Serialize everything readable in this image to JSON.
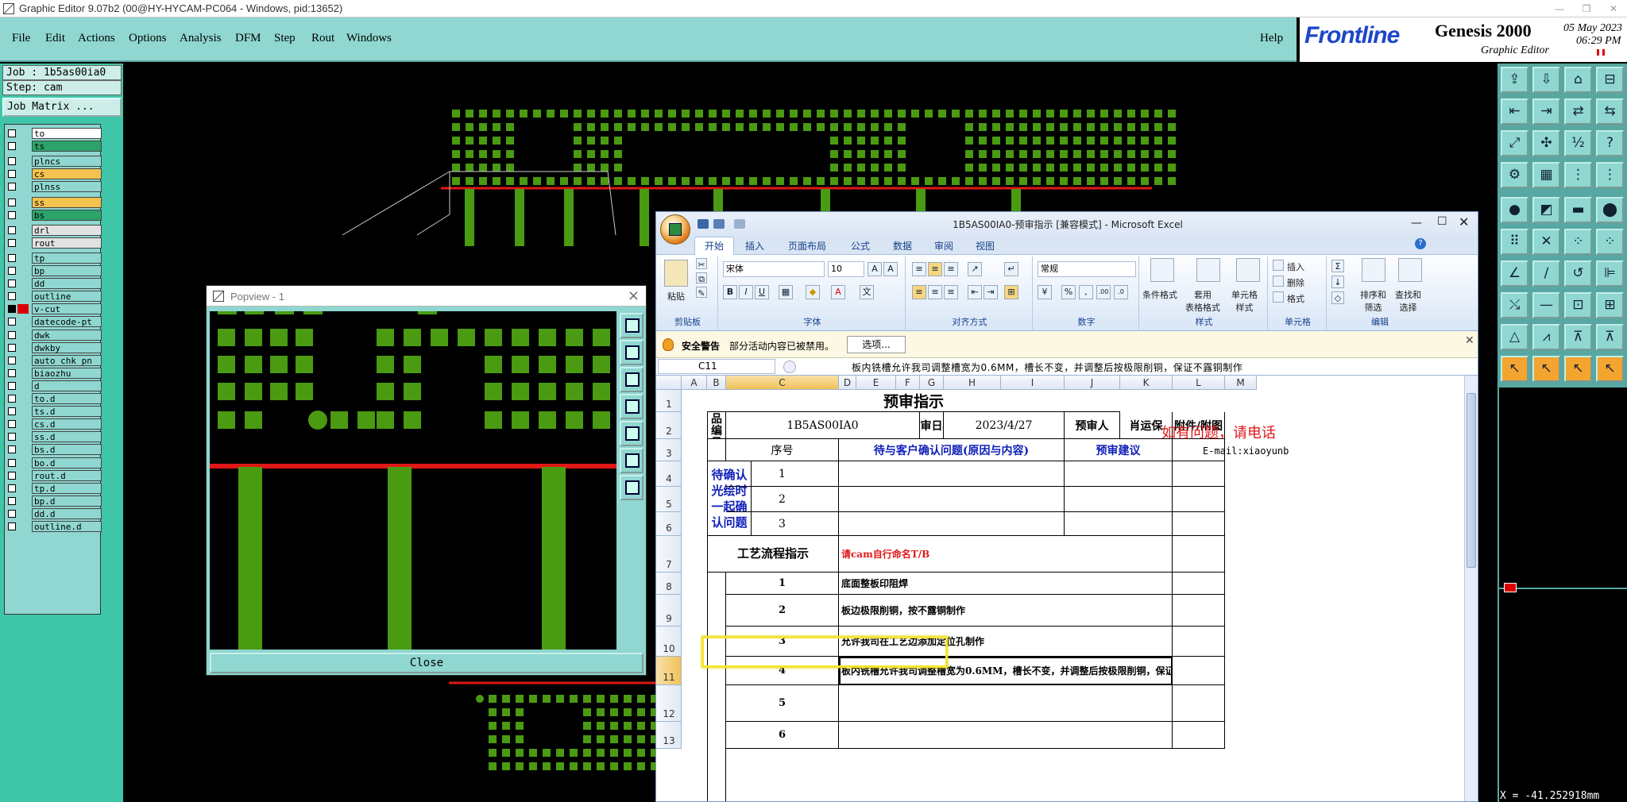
{
  "window": {
    "title": "Graphic Editor 9.07b2 (00@HY-HYCAM-PC064 - Windows, pid:13652)"
  },
  "menu": {
    "items": [
      "File",
      "Edit",
      "Actions",
      "Options",
      "Analysis",
      "DFM",
      "Step",
      "Rout",
      "Windows"
    ],
    "help": "Help"
  },
  "brand": {
    "logo": "Frontline",
    "product": "Genesis 2000",
    "subtitle": "Graphic Editor",
    "date": "05 May 2023",
    "time": "06:29 PM"
  },
  "job": {
    "job_line": "Job : 1b5as00ia0",
    "step_line": "Step: cam",
    "matrix_button": "Job Matrix ..."
  },
  "layers": [
    {
      "name": "to",
      "color": "#ffffff",
      "checked": false
    },
    {
      "name": "ts",
      "color": "#2ba36a",
      "checked": false
    },
    {
      "name": "plncs",
      "color": "#8fd7d0",
      "checked": false
    },
    {
      "name": "cs",
      "color": "#f3c24f",
      "checked": false
    },
    {
      "name": "plnss",
      "color": "#8fd7d0",
      "checked": false
    },
    {
      "name": "ss",
      "color": "#f3c24f",
      "checked": false
    },
    {
      "name": "bs",
      "color": "#2ba36a",
      "checked": false
    },
    {
      "name": "drl",
      "color": "#e2e2e2",
      "checked": false
    },
    {
      "name": "rout",
      "color": "#e2e2e2",
      "checked": false
    },
    {
      "name": "tp",
      "color": "#8fd7d0",
      "checked": false
    },
    {
      "name": "bp",
      "color": "#8fd7d0",
      "checked": false
    },
    {
      "name": "dd",
      "color": "#8fd7d0",
      "checked": false
    },
    {
      "name": "outline",
      "color": "#8fd7d0",
      "checked": false
    },
    {
      "name": "v-cut",
      "color": "#8fd7d0",
      "checked": true,
      "active": true
    },
    {
      "name": "datecode-pt",
      "color": "#8fd7d0",
      "checked": false
    },
    {
      "name": "dwk",
      "color": "#8fd7d0",
      "checked": false
    },
    {
      "name": "dwkby",
      "color": "#8fd7d0",
      "checked": false
    },
    {
      "name": "auto_chk_pn",
      "color": "#8fd7d0",
      "checked": false
    },
    {
      "name": "biaozhu",
      "color": "#8fd7d0",
      "checked": false
    },
    {
      "name": "d",
      "color": "#8fd7d0",
      "checked": false
    },
    {
      "name": "to.d",
      "color": "#8fd7d0",
      "checked": false
    },
    {
      "name": "ts.d",
      "color": "#8fd7d0",
      "checked": false
    },
    {
      "name": "cs.d",
      "color": "#8fd7d0",
      "checked": false
    },
    {
      "name": "ss.d",
      "color": "#8fd7d0",
      "checked": false
    },
    {
      "name": "bs.d",
      "color": "#8fd7d0",
      "checked": false
    },
    {
      "name": "bo.d",
      "color": "#8fd7d0",
      "checked": false
    },
    {
      "name": "rout.d",
      "color": "#8fd7d0",
      "checked": false
    },
    {
      "name": "tp.d",
      "color": "#8fd7d0",
      "checked": false
    },
    {
      "name": "bp.d",
      "color": "#8fd7d0",
      "checked": false
    },
    {
      "name": "dd.d",
      "color": "#8fd7d0",
      "checked": false
    },
    {
      "name": "outline.d",
      "color": "#8fd7d0",
      "checked": false
    }
  ],
  "popview": {
    "title": "Popview - 1",
    "close": "Close"
  },
  "coord": "X = -41.252918mm",
  "excel": {
    "title": "1B5AS00IA0-预审指示  [兼容模式] - Microsoft Excel",
    "tabs": [
      "开始",
      "插入",
      "页面布局",
      "公式",
      "数据",
      "审阅",
      "视图"
    ],
    "ribbon": {
      "paste": "粘贴",
      "clipboard": "剪贴板",
      "font_name": "宋体",
      "font_size": "10",
      "font": "字体",
      "align": "对齐方式",
      "number_format": "常规",
      "number": "数字",
      "cond_format": "条件格式",
      "table_format": "套用\n表格格式",
      "cell_style": "单元格\n样式",
      "style": "样式",
      "insert": "插入",
      "delete": "删除",
      "format": "格式",
      "cells": "单元格",
      "sort": "排序和\n筛选",
      "find": "查找和\n选择",
      "edit": "编辑"
    },
    "security": {
      "label": "安全警告",
      "message": "部分活动内容已被禁用。",
      "button": "选项..."
    },
    "name_box": "C11",
    "formula": "板内铣槽允许我司调整槽宽为0.6MM，槽长不变，并调整后按极限削铜，保证不露铜制作",
    "columns": [
      "A",
      "B",
      "C",
      "D",
      "E",
      "F",
      "G",
      "H",
      "I",
      "J",
      "K",
      "L",
      "M"
    ],
    "rows": [
      "1",
      "2",
      "3",
      "4",
      "5",
      "6",
      "7",
      "8",
      "9",
      "10",
      "11",
      "12",
      "13"
    ],
    "sheet": {
      "heading": "预审指示",
      "product_label": "产品编号",
      "product_no": "1B5AS00IA0",
      "date_label": "预审日期",
      "date": "2023/4/27",
      "reviewer_label": "预审人",
      "reviewer": "肖运保",
      "attach_label": "附件/附图",
      "contact": "如有问题，请电话",
      "email": "E-mail:xiaoyunb",
      "seq_label": "序号",
      "issues_label": "待与客户确认问题(原因与内容)",
      "suggest_label": "预审建议",
      "confirm_label": "待确认光绘时一起确认问题",
      "process_label": "工艺流程指示",
      "process_note": "请cam自行命名T/B",
      "items": [
        {
          "no": "1",
          "text": "底面整板印阻焊"
        },
        {
          "no": "2",
          "text": "板边极限削铜，按不露铜制作"
        },
        {
          "no": "3",
          "text": "允许我司在工艺边添加定位孔制作"
        },
        {
          "no": "4",
          "text": "板内铣槽允许我司调整槽宽为0.6MM，槽长不变，并调整后按极限削铜，保证不露铜制作"
        },
        {
          "no": "5",
          "text": ""
        },
        {
          "no": "6",
          "text": ""
        }
      ],
      "confirm_rows": [
        "1",
        "2",
        "3"
      ]
    }
  }
}
